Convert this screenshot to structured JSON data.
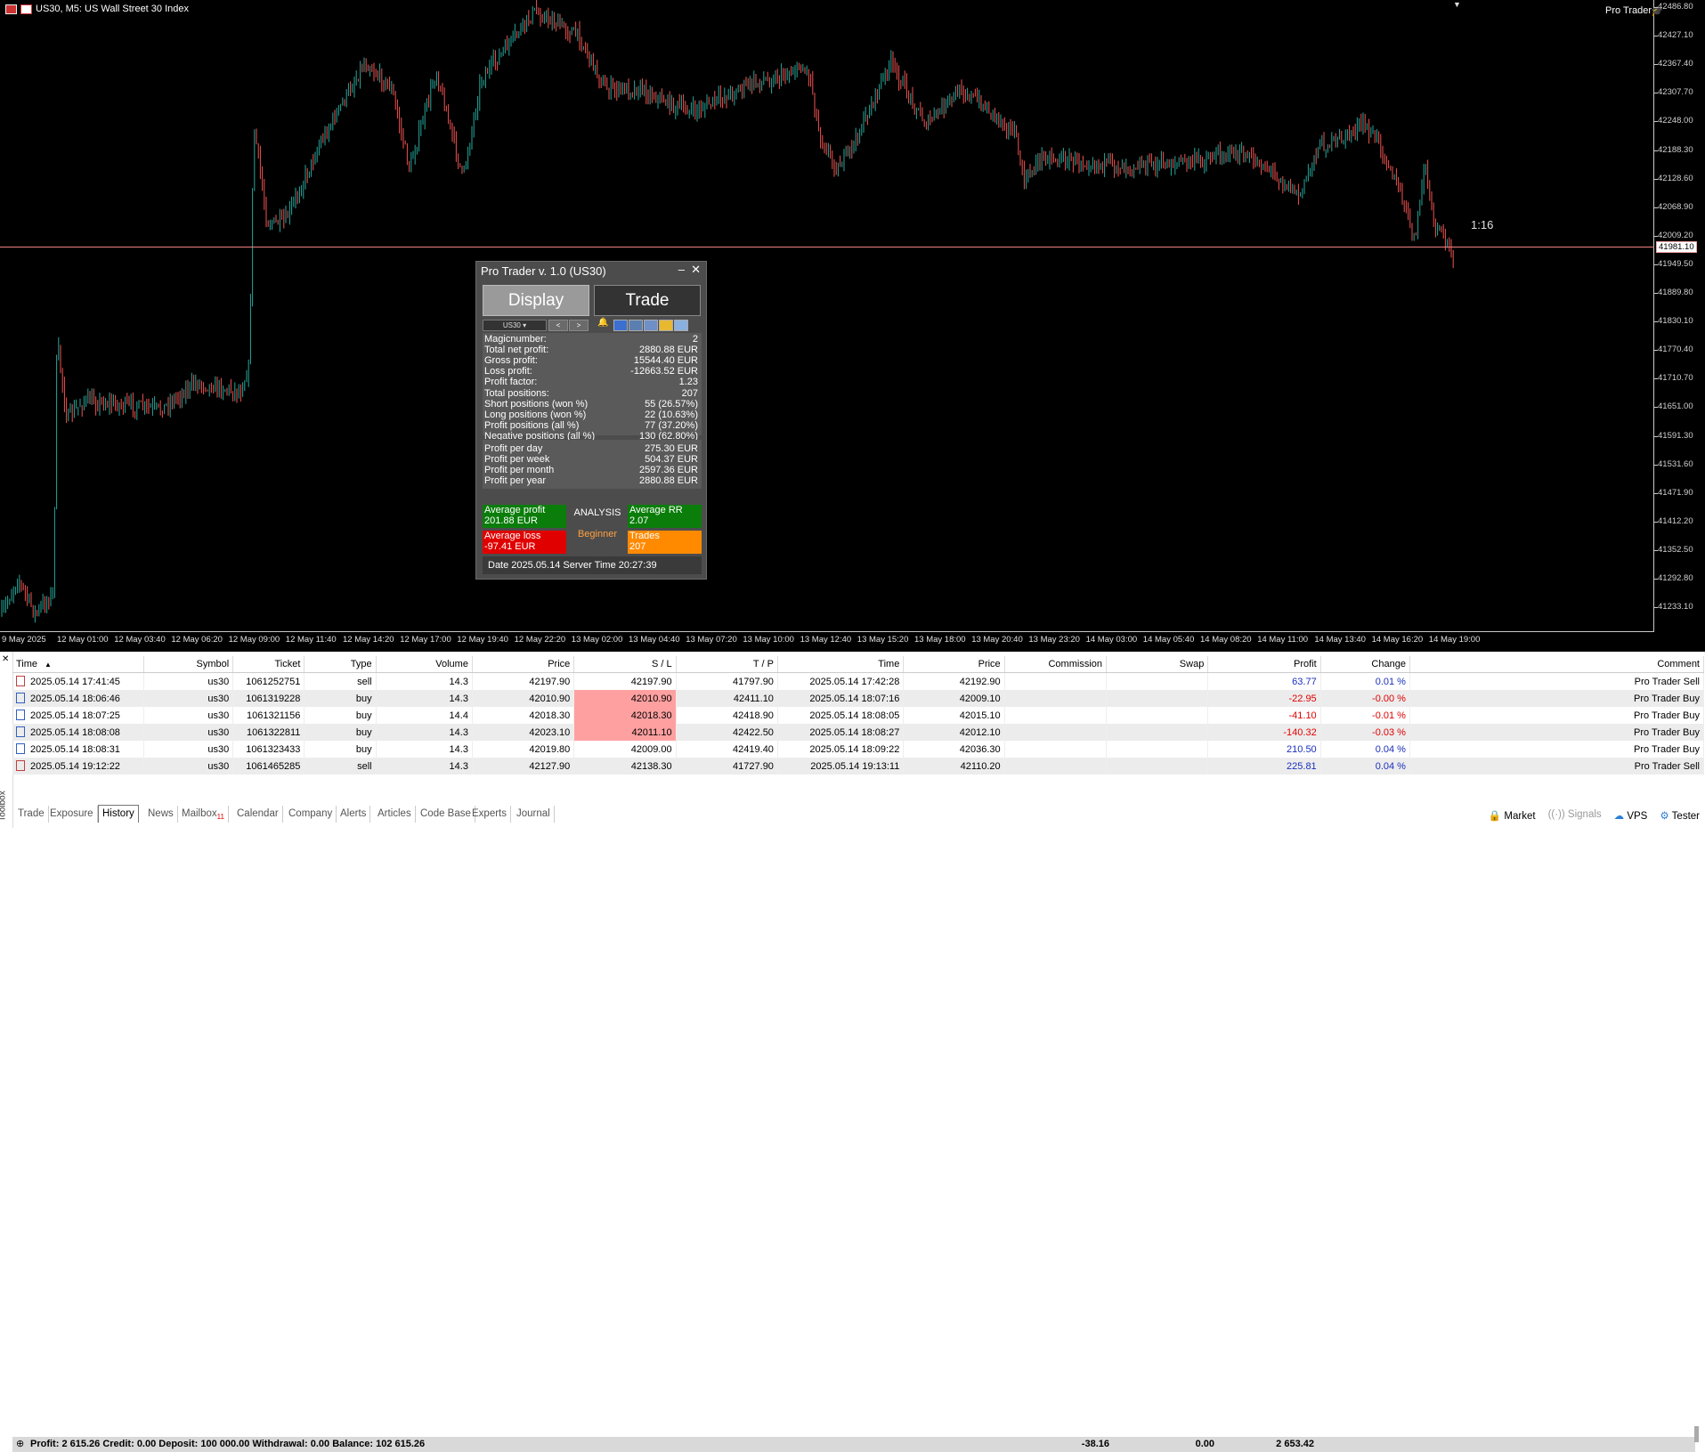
{
  "chart": {
    "title": "US30, M5:  US Wall Street 30 Index",
    "indicator_label": "Pro Trader",
    "countdown": "1:16",
    "current_price": "41981.10",
    "price_ticks": [
      "42486.80",
      "42427.10",
      "42367.40",
      "42307.70",
      "42248.00",
      "42188.30",
      "42128.60",
      "42068.90",
      "42009.20",
      "41949.50",
      "41889.80",
      "41830.10",
      "41770.40",
      "41710.70",
      "41651.00",
      "41591.30",
      "41531.60",
      "41471.90",
      "41412.20",
      "41352.50",
      "41292.80",
      "41233.10"
    ],
    "time_labels": [
      "9 May 2025",
      "12 May 01:00",
      "12 May 03:40",
      "12 May 06:20",
      "12 May 09:00",
      "12 May 11:40",
      "12 May 14:20",
      "12 May 17:00",
      "12 May 19:40",
      "12 May 22:20",
      "13 May 02:00",
      "13 May 04:40",
      "13 May 07:20",
      "13 May 10:00",
      "13 May 12:40",
      "13 May 15:20",
      "13 May 18:00",
      "13 May 20:40",
      "13 May 23:20",
      "14 May 03:00",
      "14 May 05:40",
      "14 May 08:20",
      "14 May 11:00",
      "14 May 13:40",
      "14 May 16:20",
      "14 May 19:00"
    ],
    "colors": {
      "background": "#000000",
      "bull": "#26a69a",
      "bear": "#ef5350",
      "bid_line": "#f08080"
    }
  },
  "panel": {
    "title": "Pro Trader v. 1.0 (US30)",
    "minimize": "–",
    "close": "✕",
    "tab_display": "Display",
    "tab_trade": "Trade",
    "symbol": "US30",
    "prev": "<",
    "next": ">",
    "stats": [
      {
        "label": "Magicnumber:",
        "value": "2"
      },
      {
        "label": "Total net profit:",
        "value": "2880.88 EUR"
      },
      {
        "label": "Gross profit:",
        "value": "15544.40 EUR"
      },
      {
        "label": "Loss profit:",
        "value": "-12663.52 EUR"
      },
      {
        "label": "Profit factor:",
        "value": "1.23"
      },
      {
        "label": "Total positions:",
        "value": "207"
      },
      {
        "label": "Short positions (won %)",
        "value": "55 (26.57%)"
      },
      {
        "label": "Long positions  (won %)",
        "value": "22 (10.63%)"
      },
      {
        "label": "Profit positions (all %)",
        "value": "77 (37.20%)"
      },
      {
        "label": "Negative positions (all %)",
        "value": "130 (62.80%)"
      }
    ],
    "period_stats": [
      {
        "label": "Profit per day",
        "value": "275.30 EUR"
      },
      {
        "label": "Profit per week",
        "value": "504.37 EUR"
      },
      {
        "label": "Profit per month",
        "value": "2597.36 EUR"
      },
      {
        "label": "Profit per year",
        "value": "2880.88 EUR"
      }
    ],
    "avg_profit_label": "Average profit",
    "avg_profit_value": "201.88 EUR",
    "avg_loss_label": "Average loss",
    "avg_loss_value": "-97.41 EUR",
    "analysis": "ANALYSIS",
    "level": "Beginner",
    "avg_rr_label": "Average RR",
    "avg_rr_value": "2.07",
    "trades_label": "Trades",
    "trades_value": "207",
    "status": "Date 2025.05.14 Server Time 20:27:39"
  },
  "history": {
    "columns": [
      "Time",
      "Symbol",
      "Ticket",
      "Type",
      "Volume",
      "Price",
      "S / L",
      "T / P",
      "Time",
      "Price",
      "Commission",
      "Swap",
      "Profit",
      "Change",
      "Comment"
    ],
    "sort_indicator": "▲",
    "rows": [
      {
        "open_time": "2025.05.14 17:41:45",
        "symbol": "us30",
        "ticket": "1061252751",
        "type": "sell",
        "volume": "14.3",
        "price": "42197.90",
        "sl": "42197.90",
        "tp": "41797.90",
        "close_time": "2025.05.14 17:42:28",
        "close_price": "42192.90",
        "commission": "",
        "swap": "",
        "profit": "63.77",
        "change": "0.01 %",
        "comment": "Pro Trader Sell"
      },
      {
        "open_time": "2025.05.14 18:06:46",
        "symbol": "us30",
        "ticket": "1061319228",
        "type": "buy",
        "volume": "14.3",
        "price": "42010.90",
        "sl": "42010.90",
        "tp": "42411.10",
        "close_time": "2025.05.14 18:07:16",
        "close_price": "42009.10",
        "commission": "",
        "swap": "",
        "profit": "-22.95",
        "change": "-0.00 %",
        "comment": "Pro Trader Buy"
      },
      {
        "open_time": "2025.05.14 18:07:25",
        "symbol": "us30",
        "ticket": "1061321156",
        "type": "buy",
        "volume": "14.4",
        "price": "42018.30",
        "sl": "42018.30",
        "tp": "42418.90",
        "close_time": "2025.05.14 18:08:05",
        "close_price": "42015.10",
        "commission": "",
        "swap": "",
        "profit": "-41.10",
        "change": "-0.01 %",
        "comment": "Pro Trader Buy"
      },
      {
        "open_time": "2025.05.14 18:08:08",
        "symbol": "us30",
        "ticket": "1061322811",
        "type": "buy",
        "volume": "14.3",
        "price": "42023.10",
        "sl": "42011.10",
        "tp": "42422.50",
        "close_time": "2025.05.14 18:08:27",
        "close_price": "42012.10",
        "commission": "",
        "swap": "",
        "profit": "-140.32",
        "change": "-0.03 %",
        "comment": "Pro Trader Buy"
      },
      {
        "open_time": "2025.05.14 18:08:31",
        "symbol": "us30",
        "ticket": "1061323433",
        "type": "buy",
        "volume": "14.3",
        "price": "42019.80",
        "sl": "42009.00",
        "tp": "42419.40",
        "close_time": "2025.05.14 18:09:22",
        "close_price": "42036.30",
        "commission": "",
        "swap": "",
        "profit": "210.50",
        "change": "0.04 %",
        "comment": "Pro Trader Buy"
      },
      {
        "open_time": "2025.05.14 19:12:22",
        "symbol": "us30",
        "ticket": "1061465285",
        "type": "sell",
        "volume": "14.3",
        "price": "42127.90",
        "sl": "42138.30",
        "tp": "41727.90",
        "close_time": "2025.05.14 19:13:11",
        "close_price": "42110.20",
        "commission": "",
        "swap": "",
        "profit": "225.81",
        "change": "0.04 %",
        "comment": "Pro Trader Sell"
      }
    ],
    "summary": "Profit: 2 615.26  Credit: 0.00  Deposit: 100 000.00  Withdrawal: 0.00  Balance: 102 615.26",
    "sum_commission": "-38.16",
    "sum_swap": "0.00",
    "sum_profit": "2 653.42"
  },
  "toolbox": {
    "label": "Toolbox",
    "tabs": [
      "Trade",
      "Exposure",
      "History",
      "News",
      "Mailbox",
      "Calendar",
      "Company",
      "Alerts",
      "Articles",
      "Code Base",
      "Experts",
      "Journal"
    ],
    "active_tab": "History",
    "mailbox_badge": "11",
    "status_right": {
      "market": "Market",
      "signals": "Signals",
      "vps": "VPS",
      "tester": "Tester"
    }
  }
}
